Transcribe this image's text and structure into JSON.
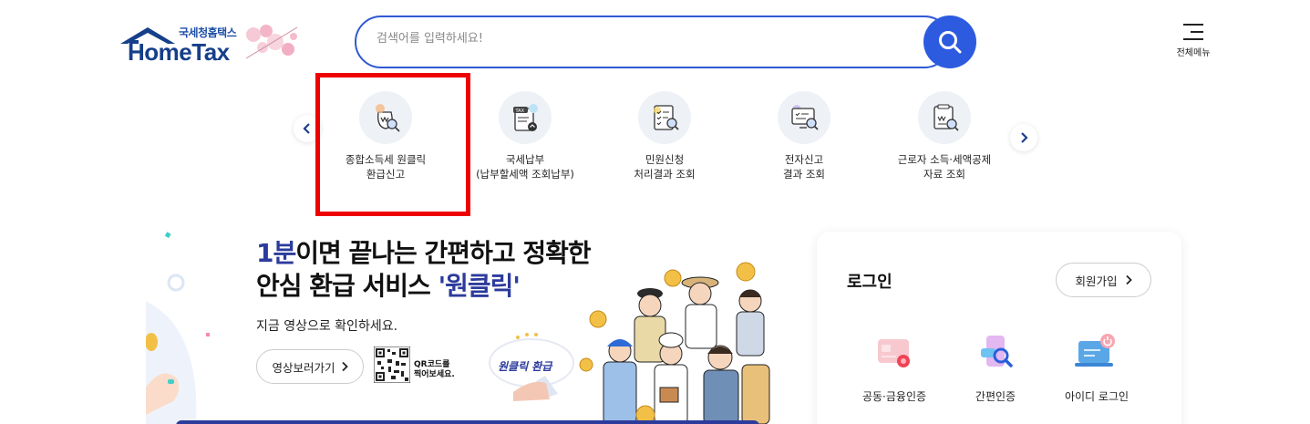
{
  "header": {
    "logo_small": "국세청홈택스",
    "logo_big": "HomeTax",
    "search_placeholder": "검색어를 입력하세요!",
    "menu_label": "전체메뉴"
  },
  "quick_menu": {
    "items": [
      {
        "label": "종합소득세 원클릭\n환급신고",
        "icon": "income-tax-refund-icon",
        "highlighted": true
      },
      {
        "label": "국세납부\n(납부할세액 조회납부)",
        "icon": "tax-payment-icon"
      },
      {
        "label": "민원신청\n처리결과 조회",
        "icon": "civil-request-icon"
      },
      {
        "label": "전자신고\n결과 조회",
        "icon": "e-filing-result-icon"
      },
      {
        "label": "근로자 소득·세액공제\n자료 조회",
        "icon": "deduction-data-icon"
      }
    ]
  },
  "banner": {
    "title_accent": "1분",
    "title_rest": "이면 끝나는 간편하고 정확한",
    "title_line2_a": "안심 환급 서비스 ",
    "title_line2_b": "'원클릭'",
    "subtitle": "지금 영상으로 확인하세요.",
    "video_button": "영상보러가기",
    "qr_text": "QR코드를\n찍어보세요.",
    "badge_text": "원클릭 환급"
  },
  "login": {
    "title": "로그인",
    "join_button": "회원가입",
    "options": [
      {
        "label": "공동·금융인증",
        "icon": "certificate-icon"
      },
      {
        "label": "간편인증",
        "icon": "simple-auth-icon"
      },
      {
        "label": "아이디 로그인",
        "icon": "id-login-icon"
      }
    ]
  },
  "colors": {
    "accent": "#2d5be0",
    "highlight": "#ee0000",
    "brand_navy": "#163f8a"
  }
}
